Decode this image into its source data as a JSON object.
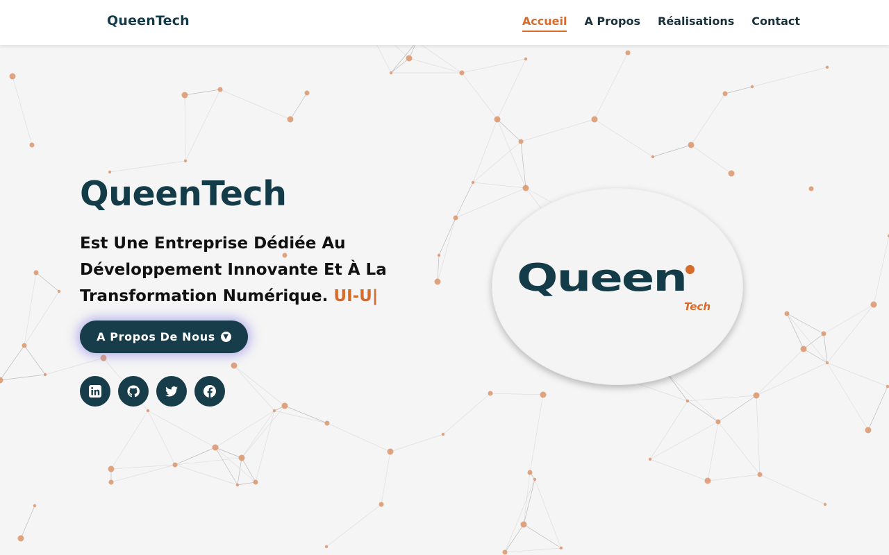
{
  "header": {
    "brand": "QueenTech",
    "nav": [
      {
        "label": "Accueil",
        "active": true
      },
      {
        "label": "A Propos",
        "active": false
      },
      {
        "label": "Réalisations",
        "active": false
      },
      {
        "label": "Contact",
        "active": false
      }
    ]
  },
  "hero": {
    "title": "QueenTech",
    "subtitle": "Est Une Entreprise Dédiée Au Développement Innovante Et À La Transformation Numérique.",
    "typed_text": "UI-U|",
    "cta_label": "A Propos De Nous",
    "cta_icon": "arrow-circle-down-icon"
  },
  "socials": [
    {
      "name": "linkedin-icon"
    },
    {
      "name": "github-icon"
    },
    {
      "name": "twitter-icon"
    },
    {
      "name": "facebook-icon"
    }
  ],
  "logo": {
    "word": "Queen",
    "sub": "Tech"
  },
  "colors": {
    "primary": "#143c48",
    "accent": "#d86a2a",
    "background": "#f5f5f5"
  }
}
